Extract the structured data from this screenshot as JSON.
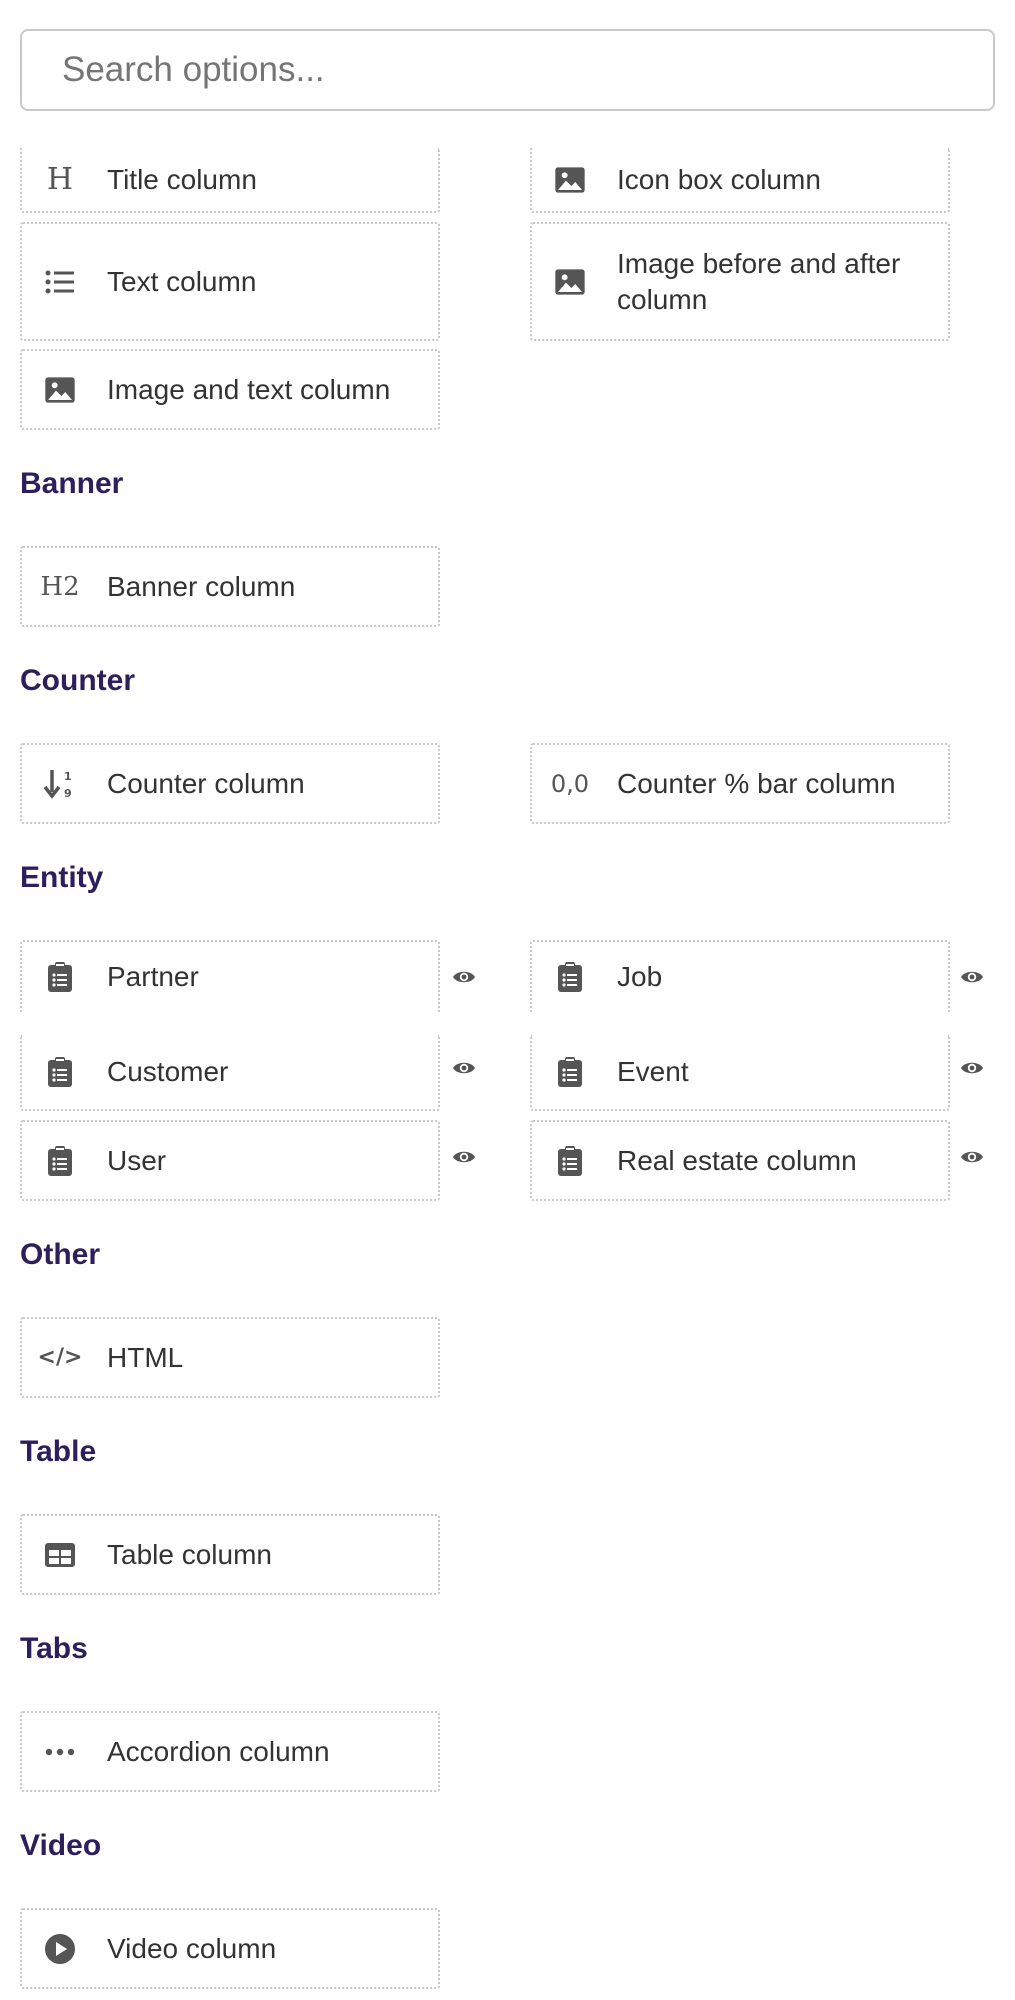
{
  "search": {
    "placeholder": "Search options..."
  },
  "items": {
    "title": "Title column",
    "icon_box": "Icon box column",
    "text": "Text column",
    "image_before_after": "Image before and after column",
    "image_text": "Image and text column"
  },
  "sections": {
    "banner": {
      "heading": "Banner",
      "items": {
        "banner": "Banner column"
      }
    },
    "counter": {
      "heading": "Counter",
      "items": {
        "counter": "Counter column",
        "counter_bar": "Counter % bar column"
      }
    },
    "entity": {
      "heading": "Entity",
      "items": {
        "partner": "Partner",
        "job": "Job",
        "customer": "Customer",
        "event": "Event",
        "user": "User",
        "real_estate": "Real estate column"
      }
    },
    "other": {
      "heading": "Other",
      "items": {
        "html": "HTML"
      }
    },
    "table": {
      "heading": "Table",
      "items": {
        "table": "Table column"
      }
    },
    "tabs": {
      "heading": "Tabs",
      "items": {
        "accordion": "Accordion column"
      }
    },
    "video": {
      "heading": "Video",
      "items": {
        "video": "Video column"
      }
    }
  },
  "icons": {
    "h1_glyph": "H",
    "h2_glyph": "H2",
    "counter_bar_glyph": "0,0",
    "html_glyph": "</>"
  },
  "colors": {
    "heading": "#2d1f5c",
    "text": "#333333",
    "icon": "#555555",
    "card_border": "#c8c8c8"
  }
}
